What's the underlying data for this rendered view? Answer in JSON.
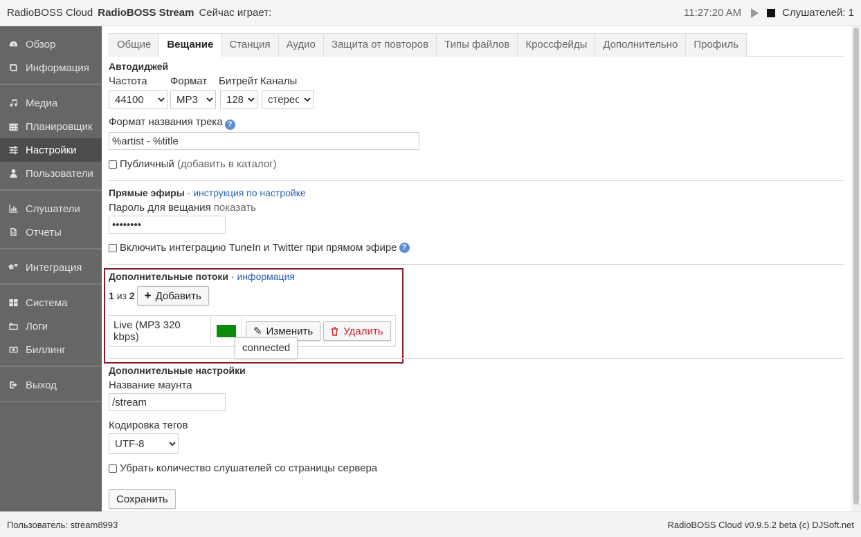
{
  "header": {
    "app_name": "RadioBOSS Cloud",
    "station": "RadioBOSS Stream",
    "now_playing_label": "Сейчас играет:",
    "time": "11:27:20 AM",
    "listeners": "Слушателей: 1"
  },
  "sidebar": {
    "groups": [
      [
        {
          "label": "Обзор",
          "icon": "dashboard-icon"
        },
        {
          "label": "Информация",
          "icon": "book-icon"
        }
      ],
      [
        {
          "label": "Медиа",
          "icon": "music-note-icon"
        },
        {
          "label": "Планировщик",
          "icon": "calendar-icon"
        },
        {
          "label": "Настройки",
          "icon": "sliders-icon",
          "active": true
        },
        {
          "label": "Пользователи",
          "icon": "user-icon"
        }
      ],
      [
        {
          "label": "Слушатели",
          "icon": "bar-chart-icon"
        },
        {
          "label": "Отчеты",
          "icon": "document-icon"
        }
      ],
      [
        {
          "label": "Интеграция",
          "icon": "gears-icon"
        }
      ],
      [
        {
          "label": "Система",
          "icon": "grid-icon"
        },
        {
          "label": "Логи",
          "icon": "folder-icon"
        },
        {
          "label": "Биллинг",
          "icon": "money-icon"
        }
      ],
      [
        {
          "label": "Выход",
          "icon": "logout-icon"
        }
      ]
    ]
  },
  "tabs": [
    "Общие",
    "Вещание",
    "Станция",
    "Аудио",
    "Защита от повторов",
    "Типы файлов",
    "Кроссфейды",
    "Дополнительно",
    "Профиль"
  ],
  "active_tab": "Вещание",
  "autodj": {
    "title": "Автодиджей",
    "labels": {
      "frequency": "Частота",
      "format": "Формат",
      "bitrate": "Битрейт",
      "channels": "Каналы"
    },
    "values": {
      "frequency": "44100",
      "format": "MP3",
      "bitrate": "128",
      "channels": "стерео"
    },
    "track_format_label": "Формат названия трека",
    "track_format_value": "%artist - %title",
    "public_label": "Публичный",
    "public_hint": "(добавить в каталог)"
  },
  "live": {
    "title": "Прямые эфиры",
    "separator": "·",
    "link": "инструкция по настройке",
    "password_label": "Пароль для вещания",
    "password_show": "показать",
    "password_value": "••••••••",
    "integration_label": "Включить интеграцию TuneIn и Twitter при прямом эфире"
  },
  "extra_streams": {
    "title": "Дополнительные потоки",
    "separator": "·",
    "link": "информация",
    "count_current": "1",
    "count_of": "из",
    "count_total": "2",
    "add_button": "Добавить",
    "stream_name": "Live (MP3 320 kbps)",
    "status_color": "#0a8a0a",
    "edit_button": "Изменить",
    "delete_button": "Удалить",
    "tooltip": "connected"
  },
  "extra_settings": {
    "title": "Дополнительные настройки",
    "mount_label": "Название маунта",
    "mount_value": "/stream",
    "encoding_label": "Кодировка тегов",
    "encoding_value": "UTF-8",
    "hide_listeners_label": "Убрать количество слушателей со страницы сервера",
    "save_button": "Сохранить"
  },
  "footer": {
    "user": "Пользователь: stream8993",
    "version": "RadioBOSS Cloud v0.9.5.2 beta (c) DJSoft.net"
  }
}
